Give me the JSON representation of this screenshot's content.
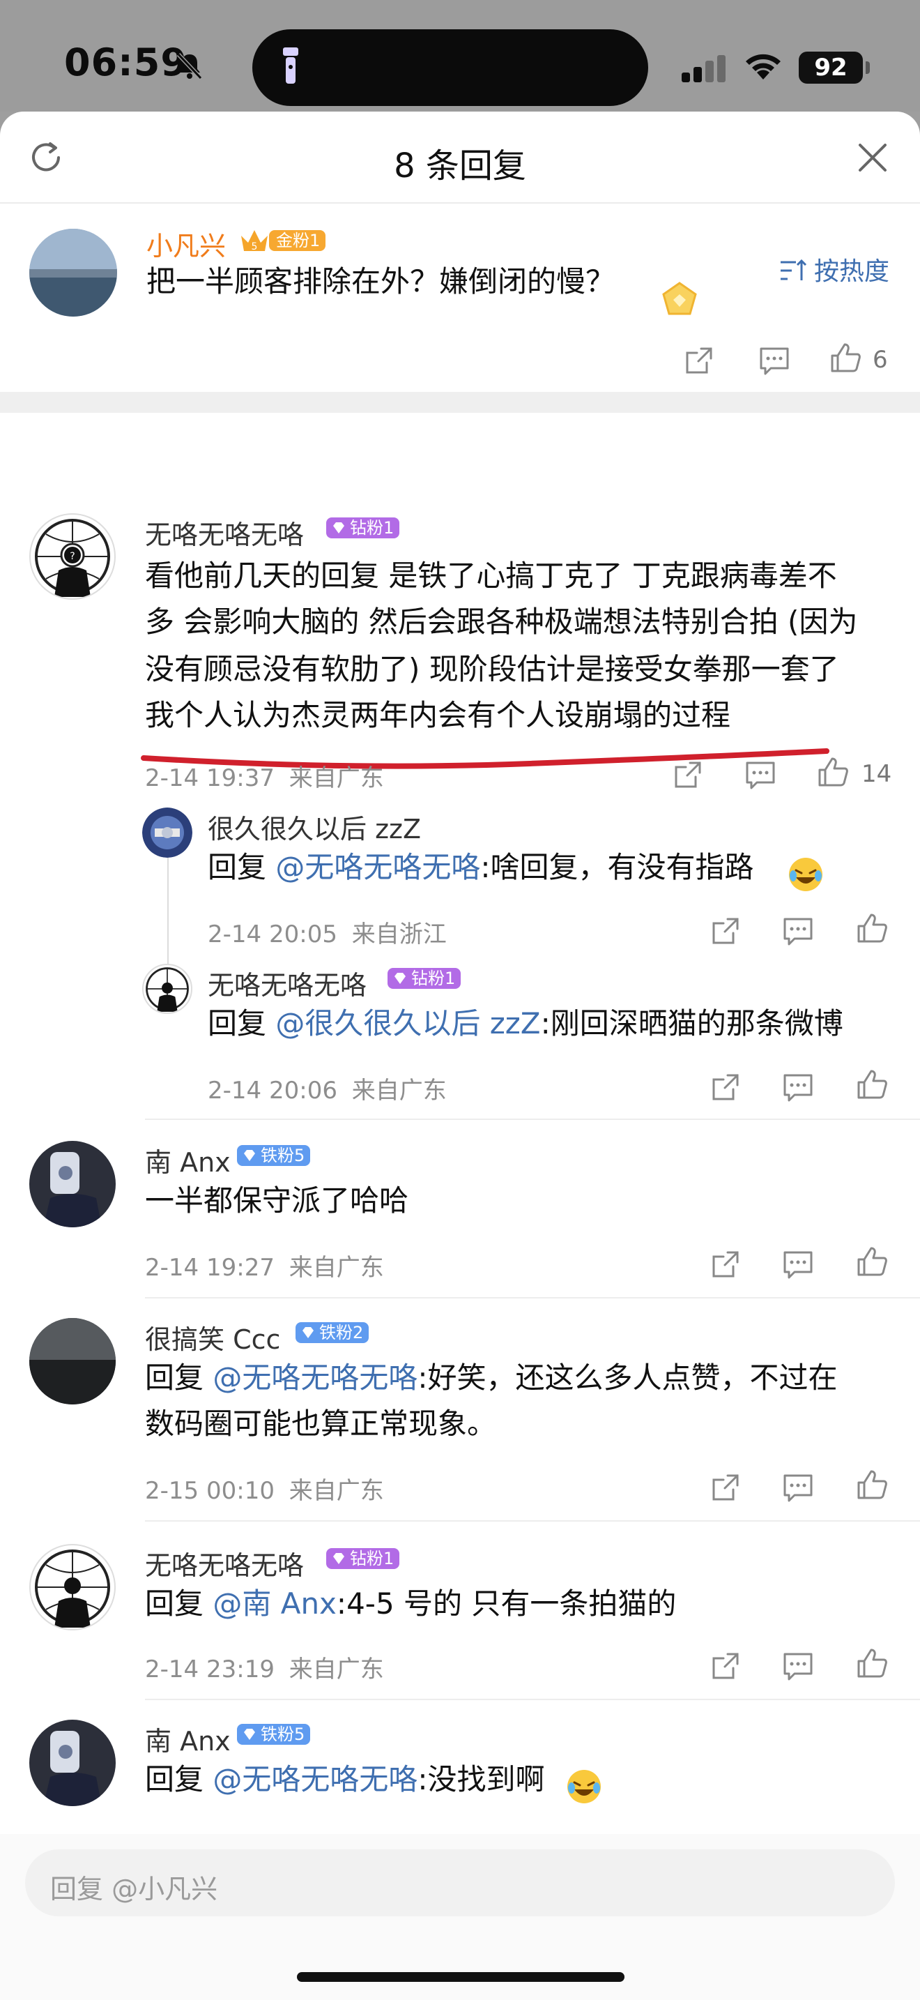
{
  "status_bar": {
    "time": "06:59",
    "battery": "92"
  },
  "sheet": {
    "title": "8 条回复"
  },
  "original_comment": {
    "author": "小凡兴",
    "badge": "金粉1",
    "badge_level": "5",
    "text": "把一半顾客排除在外？嫌倒闭的慢？",
    "likes": "6"
  },
  "sort": {
    "label": "按热度"
  },
  "replies": [
    {
      "author": "无咯无咯无咯",
      "badge": "钻粉1",
      "lines": [
        "看他前几天的回复 是铁了心搞丁克了 丁克跟病毒差不",
        "多 会影响大脑的 然后会跟各种极端想法特别合拍 (因为",
        "没有顾忌没有软肋了) 现阶段估计是接受女拳那一套了",
        "我个人认为杰灵两年内会有个人设崩塌的过程"
      ],
      "date": "2-14 19:37",
      "location": "来自广东",
      "likes": "14",
      "sub_replies": [
        {
          "author": "很久很久以后 zzZ",
          "prefix": "回复 ",
          "mention": "@无咯无咯无咯",
          "text": ":啥回复，有没有指路",
          "date": "2-14 20:05",
          "location": "来自浙江"
        },
        {
          "author": "无咯无咯无咯",
          "badge": "钻粉1",
          "prefix": "回复 ",
          "mention": "@很久很久以后 zzZ",
          "text": ":刚回深晒猫的那条微博",
          "date": "2-14 20:06",
          "location": "来自广东"
        }
      ]
    },
    {
      "author": "南 Anx",
      "badge": "铁粉5",
      "text": "一半都保守派了哈哈",
      "date": "2-14 19:27",
      "location": "来自广东"
    },
    {
      "author": "很搞笑 Ccc",
      "badge": "铁粉2",
      "prefix": "回复 ",
      "mention": "@无咯无咯无咯",
      "text": ":好笑，还这么多人点赞，不过在",
      "text2": "数码圈可能也算正常现象。",
      "date": "2-15 00:10",
      "location": "来自广东"
    },
    {
      "author": "无咯无咯无咯",
      "badge": "钻粉1",
      "prefix": "回复 ",
      "mention": "@南 Anx",
      "text": ":4-5 号的 只有一条拍猫的",
      "date": "2-14 23:19",
      "location": "来自广东"
    },
    {
      "author": "南 Anx",
      "badge": "铁粉5",
      "prefix": "回复 ",
      "mention": "@无咯无咯无咯",
      "text": ":没找到啊"
    }
  ],
  "reply_input": {
    "placeholder": "回复 @小凡兴"
  },
  "colors": {
    "mention": "#3f6fb0",
    "diamond_badge": "#b26be6",
    "iron_badge": "#5f9bf0",
    "gold_badge": "#f7a831",
    "author_highlight": "#f07c1b",
    "underline": "#d0202c"
  }
}
